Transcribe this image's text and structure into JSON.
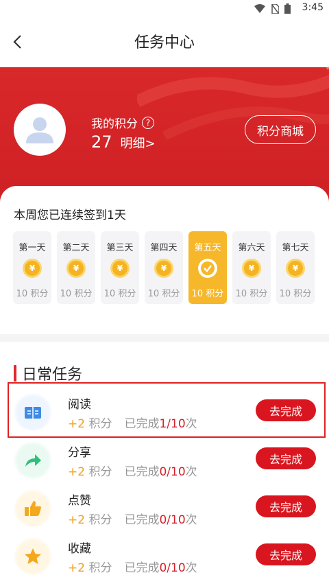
{
  "status_bar": {
    "time": "3:45"
  },
  "nav": {
    "title": "任务中心"
  },
  "profile": {
    "points_label": "我的积分",
    "help_symbol": "?",
    "points_value": "27",
    "detail_link": "明细>",
    "mall_button": "积分商城"
  },
  "checkin": {
    "title": "本周您已连续签到1天",
    "coin_symbol": "¥",
    "days": [
      {
        "label": "第一天",
        "points": "10 积分",
        "checked": false
      },
      {
        "label": "第二天",
        "points": "10 积分",
        "checked": false
      },
      {
        "label": "第三天",
        "points": "10 积分",
        "checked": false
      },
      {
        "label": "第四天",
        "points": "10 积分",
        "checked": false
      },
      {
        "label": "第五天",
        "points": "10 积分",
        "checked": true
      },
      {
        "label": "第六天",
        "points": "10 积分",
        "checked": false
      },
      {
        "label": "第七天",
        "points": "10 积分",
        "checked": false
      }
    ]
  },
  "daily_tasks": {
    "title": "日常任务",
    "items": [
      {
        "name": "阅读",
        "reward_plus": "+2",
        "reward_unit": "积分",
        "progress_prefix": "已完成",
        "progress_done": "1",
        "progress_total": "/10",
        "progress_suffix": "次",
        "button": "去完成",
        "icon": "book-icon"
      },
      {
        "name": "分享",
        "reward_plus": "+2",
        "reward_unit": "积分",
        "progress_prefix": "已完成",
        "progress_done": "0",
        "progress_total": "/10",
        "progress_suffix": "次",
        "button": "去完成",
        "icon": "share-icon"
      },
      {
        "name": "点赞",
        "reward_plus": "+2",
        "reward_unit": "积分",
        "progress_prefix": "已完成",
        "progress_done": "0",
        "progress_total": "/10",
        "progress_suffix": "次",
        "button": "去完成",
        "icon": "thumbs-up-icon"
      },
      {
        "name": "收藏",
        "reward_plus": "+2",
        "reward_unit": "积分",
        "progress_prefix": "已完成",
        "progress_done": "0",
        "progress_total": "/10",
        "progress_suffix": "次",
        "button": "去完成",
        "icon": "star-icon"
      }
    ]
  },
  "colors": {
    "brand_red": "#d9161f",
    "gold": "#f6b72a",
    "highlight": "#e02020"
  }
}
